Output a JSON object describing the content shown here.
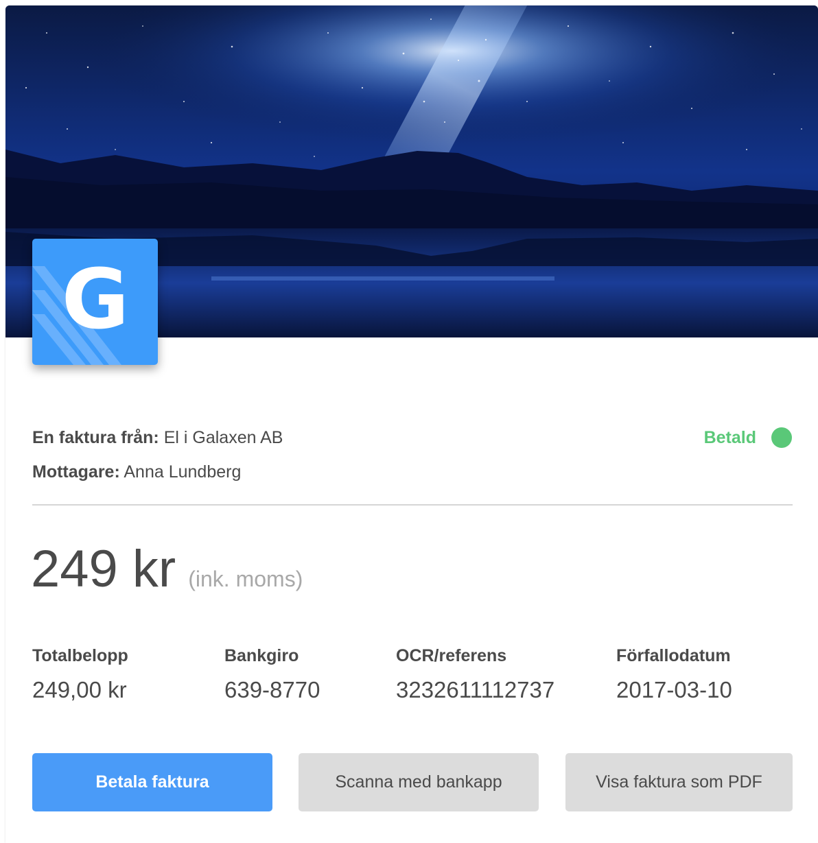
{
  "invoice": {
    "from_label": "En faktura från:",
    "from_value": "El i Galaxen AB",
    "recipient_label": "Mottagare:",
    "recipient_value": "Anna Lundberg",
    "status": "Betald",
    "status_color": "#5ac878",
    "amount": "249 kr",
    "amount_note": "(ink. moms)",
    "logo_letter": "G",
    "logo_color": "#3d9bfa"
  },
  "facts": [
    {
      "label": "Totalbelopp",
      "value": "249,00 kr"
    },
    {
      "label": "Bankgiro",
      "value": "639-8770"
    },
    {
      "label": "OCR/referens",
      "value": "3232611112737"
    },
    {
      "label": "Förfallodatum",
      "value": "2017-03-10"
    }
  ],
  "actions": {
    "pay_label": "Betala faktura",
    "scan_label": "Scanna med bankapp",
    "pdf_label": "Visa faktura som PDF",
    "primary_color": "#4a9bf8"
  },
  "icons": {
    "hero": "night-sky-mountain-image",
    "logo": "galaxen-logo-icon",
    "status": "status-dot-icon"
  }
}
